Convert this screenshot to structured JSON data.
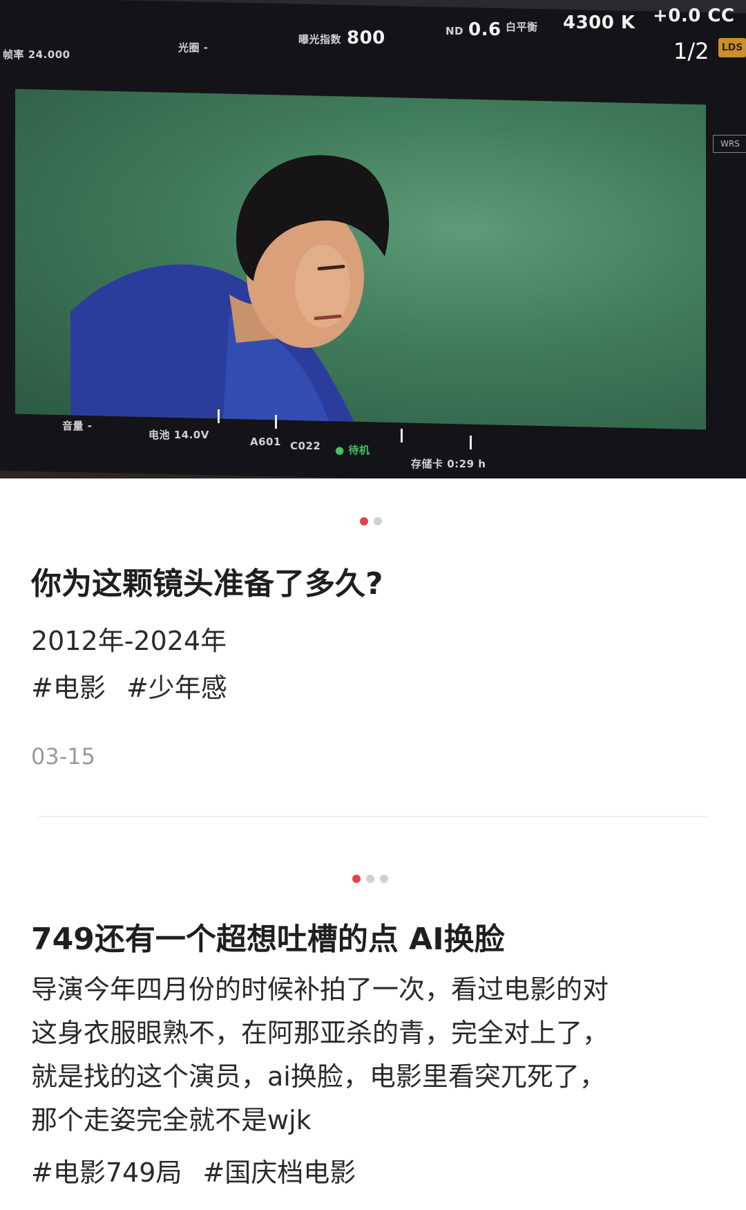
{
  "post1": {
    "photo": {
      "hud": {
        "top_left": "帧率 24.000",
        "iris": "光圈 -",
        "exposure_label": "曝光指数",
        "exposure_value": "800",
        "nd_label": "ND",
        "nd_value": "0.6",
        "wb_label": "白平衡",
        "kelvin": "4300 K",
        "tint": "+0.0 CC",
        "volume": "音量 -",
        "battery": "电池 14.0V",
        "clip": "A601",
        "clip2": "C022",
        "status": "待机",
        "storage": "存储卡 0:29 h",
        "lds": "LDS",
        "wrs": "WRS"
      },
      "page_indicator": "1/2"
    },
    "dots": {
      "count": 2,
      "active": 0
    },
    "title": "你为这颗镜头准备了多久?",
    "line": "2012年-2024年",
    "tags": [
      "#电影",
      "#少年感"
    ],
    "date": "03-15"
  },
  "post2": {
    "dots": {
      "count": 3,
      "active": 0
    },
    "title": "749还有一个超想吐槽的点 AI换脸",
    "body_lines": [
      "导演今年四月份的时候补拍了一次，看过电影的对",
      "这身衣服眼熟不，在阿那亚杀的青，完全对上了，",
      "就是找的这个演员，ai换脸，电影里看突兀死了，",
      "那个走姿完全就不是wjk"
    ],
    "tags": [
      "#电影749局",
      "#国庆档电影"
    ]
  },
  "colors": {
    "accent_dot": "#e2434b",
    "inactive_dot": "#d0d0d0",
    "date_gray": "#9a9a9a",
    "text": "#2a2a2a"
  }
}
